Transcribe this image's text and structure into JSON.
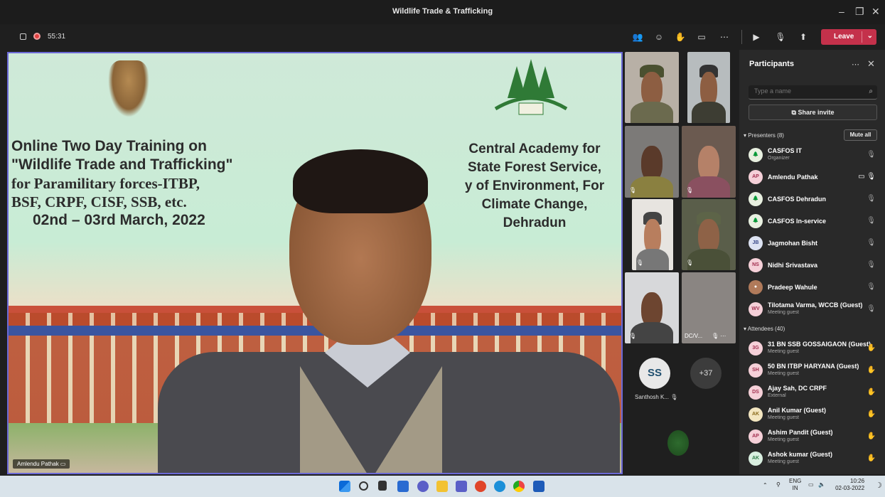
{
  "window": {
    "title": "Wildlife Trade & Trafficking"
  },
  "meeting": {
    "timer": "55:31",
    "leave_label": "Leave"
  },
  "colors": {
    "leave": "#c4314b",
    "accent": "#6b69d6"
  },
  "stage": {
    "speaker_name": "Amlendu Pathak",
    "banner_left": [
      "Online Two Day Training on",
      "\"Wildlife Trade and Trafficking\"",
      "for Paramilitary forces-ITBP,",
      "BSF, CRPF, CISF, SSB, etc.",
      "02nd – 03rd March, 2022"
    ],
    "banner_right": [
      "Central Academy for",
      "State Forest Service,",
      "y of Environment, For",
      "Climate Change,",
      "Dehradun"
    ]
  },
  "gallery": {
    "tile_label": "DC/V...",
    "big_avatar": "SS",
    "big_avatar_name": "Santhosh K...",
    "more_count": "+37"
  },
  "panel": {
    "title": "Participants",
    "search_placeholder": "Type a name",
    "share_invite": "Share invite",
    "presenters_header": "Presenters (8)",
    "mute_all": "Mute all",
    "attendees_header": "Attendees (40)",
    "presenters": [
      {
        "initials": "",
        "name": "CASFOS IT",
        "sub": "Organizer"
      },
      {
        "initials": "AP",
        "name": "Amlendu Pathak",
        "sub": ""
      },
      {
        "initials": "",
        "name": "CASFOS Dehradun",
        "sub": ""
      },
      {
        "initials": "",
        "name": "CASFOS In-service",
        "sub": ""
      },
      {
        "initials": "JB",
        "name": "Jagmohan Bisht",
        "sub": ""
      },
      {
        "initials": "NS",
        "name": "Nidhi Srivastava",
        "sub": ""
      },
      {
        "initials": "",
        "name": "Pradeep Wahule",
        "sub": ""
      },
      {
        "initials": "WV",
        "name": "Tilotama Varma, WCCB (Guest)",
        "sub": "Meeting guest"
      }
    ],
    "attendees": [
      {
        "initials": "3G",
        "name": "31 BN SSB GOSSAIGAON (Guest)",
        "sub": "Meeting guest"
      },
      {
        "initials": "SH",
        "name": "50 BN ITBP HARYANA (Guest)",
        "sub": "Meeting guest"
      },
      {
        "initials": "DS",
        "name": "Ajay Sah, DC CRPF",
        "sub": "External"
      },
      {
        "initials": "AK",
        "name": "Anil Kumar (Guest)",
        "sub": "Meeting guest"
      },
      {
        "initials": "AP",
        "name": "Ashim Pandit (Guest)",
        "sub": "Meeting guest"
      },
      {
        "initials": "AK",
        "name": "Ashok kumar (Guest)",
        "sub": "Meeting guest"
      }
    ]
  },
  "taskbar": {
    "lang": "ENG",
    "region": "IN",
    "time": "10:26",
    "date": "02-03-2022"
  }
}
